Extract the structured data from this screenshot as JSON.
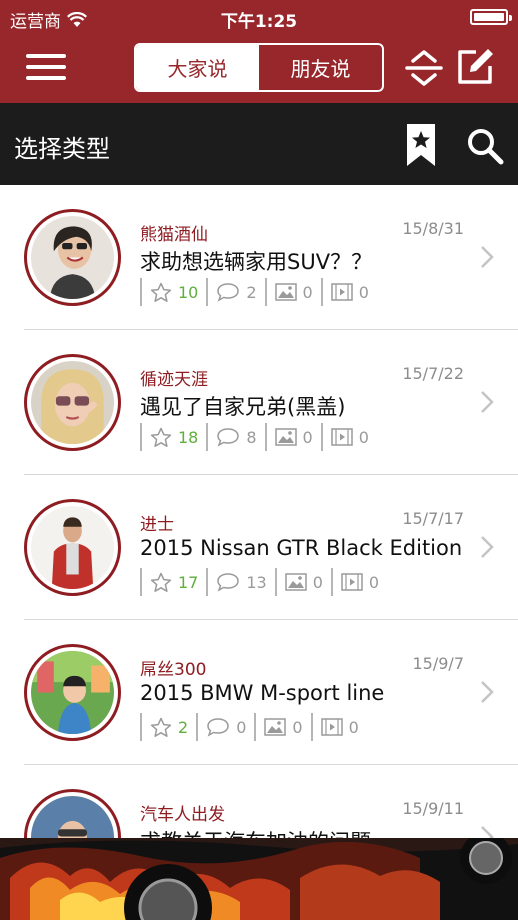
{
  "status": {
    "carrier": "运营商",
    "time": "下午1:25"
  },
  "nav": {
    "tabs": [
      "大家说",
      "朋友说"
    ],
    "active_tab": 0
  },
  "filter": {
    "title": "选择类型"
  },
  "posts": [
    {
      "author": "熊猫酒仙",
      "date": "15/8/31",
      "title": "求助想选辆家用SUV？？",
      "likes": "10",
      "comments": "2",
      "images": "0",
      "videos": "0"
    },
    {
      "author": "循迹天涯",
      "date": "15/7/22",
      "title": "遇见了自家兄弟(黑盖)",
      "likes": "18",
      "comments": "8",
      "images": "0",
      "videos": "0"
    },
    {
      "author": "进士",
      "date": "15/7/17",
      "title": "2015 Nissan GTR Black Edition",
      "likes": "17",
      "comments": "13",
      "images": "0",
      "videos": "0"
    },
    {
      "author": "屌丝300",
      "date": "15/9/7",
      "title": "2015 BMW M-sport line",
      "likes": "2",
      "comments": "0",
      "images": "0",
      "videos": "0"
    },
    {
      "author": "汽车人出发",
      "date": "15/9/11",
      "title": "求教关于汽车加油的问题",
      "likes": "",
      "comments": "",
      "images": "",
      "videos": ""
    }
  ],
  "colors": {
    "brand_red": "#97272b",
    "author_red": "#8e1d22",
    "likes_green": "#5fae3e",
    "filter_bar": "#1c1c1c"
  }
}
